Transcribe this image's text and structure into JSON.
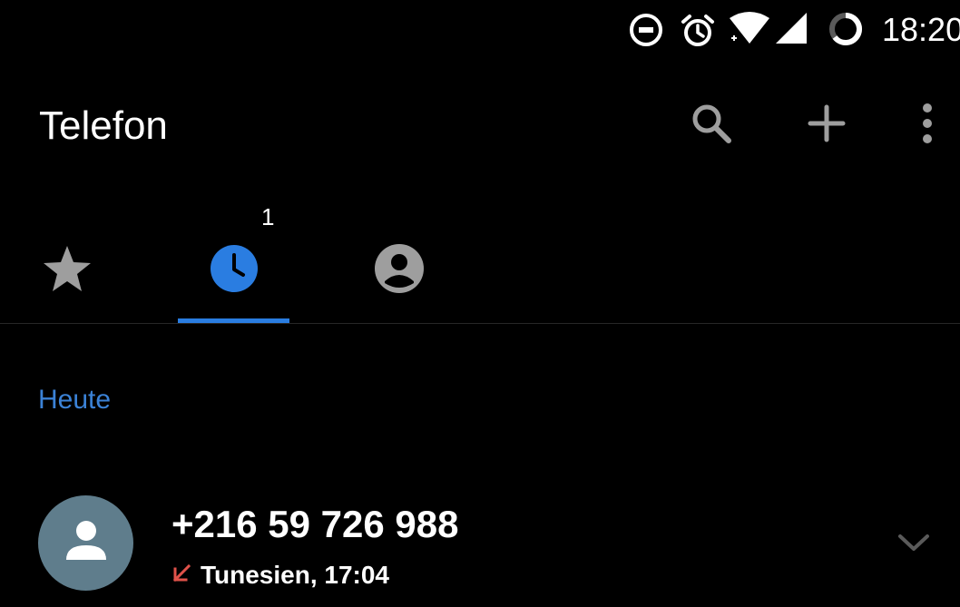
{
  "status_bar": {
    "time": "18:20",
    "icons": [
      "do-not-disturb-icon",
      "alarm-icon",
      "wifi-icon",
      "cell-signal-icon",
      "battery-icon"
    ]
  },
  "app_bar": {
    "title": "Telefon",
    "actions": [
      "search-icon",
      "add-icon",
      "more-vert-icon"
    ]
  },
  "tabs": {
    "items": [
      "favorites-star-icon",
      "recents-clock-icon",
      "contacts-person-icon"
    ],
    "selected": "recents-clock-icon",
    "recents_badge": "1"
  },
  "colors": {
    "accent": "#2a7de1",
    "section_header": "#3b82d6",
    "missed_call": "#e0524a",
    "avatar_bg": "#5f7d8c",
    "icon_gray": "#9e9e9e"
  },
  "call_log": {
    "section_header": "Heute",
    "entries": [
      {
        "number": "+216 59 726 988",
        "call_type_icon": "missed-call-icon",
        "detail": "Tunesien, 17:04",
        "avatar_icon": "person-icon"
      }
    ]
  }
}
